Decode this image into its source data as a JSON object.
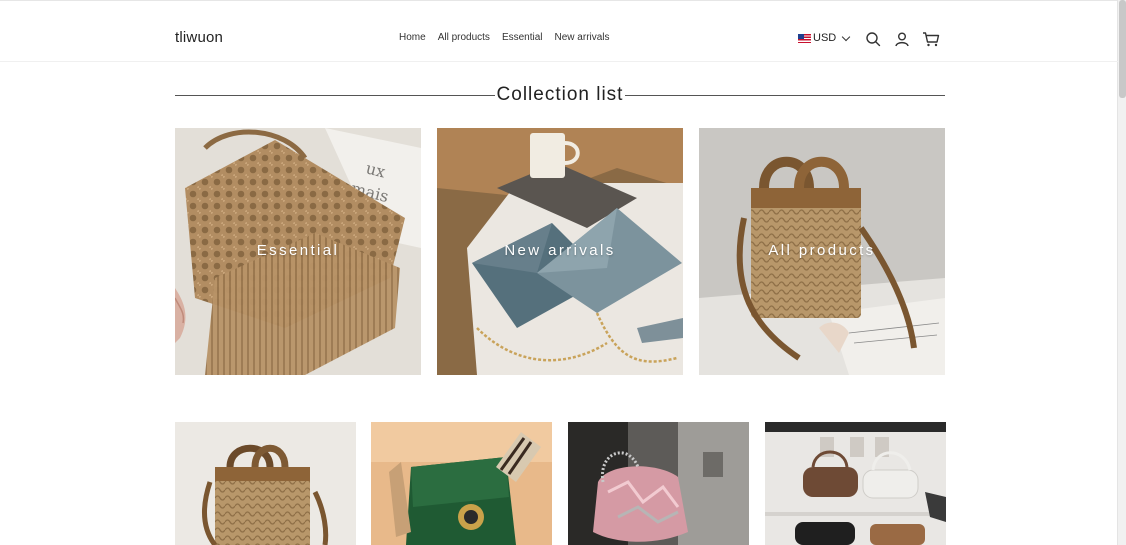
{
  "header": {
    "logo": "tliwuon",
    "nav": [
      "Home",
      "All products",
      "Essential",
      "New arrivals"
    ],
    "currency": "USD",
    "icons": [
      "search-icon",
      "account-icon",
      "cart-icon"
    ]
  },
  "section": {
    "title": "Collection list"
  },
  "collections": [
    {
      "label": "Essential",
      "image": "crochet fringe bag"
    },
    {
      "label": "New arrivals",
      "image": "blue envelope clutches with chain"
    },
    {
      "label": "All products",
      "image": "straw tote with leather handles"
    }
  ],
  "products": [
    {
      "image": "straw basket bag"
    },
    {
      "image": "green leather shoulder bag with striped strap"
    },
    {
      "image": "pink sequin chain bag"
    },
    {
      "image": "group of small shoulder bags"
    }
  ],
  "colors": {
    "text": "#222222",
    "line": "#555555",
    "overlay_text": "#ffffff"
  }
}
